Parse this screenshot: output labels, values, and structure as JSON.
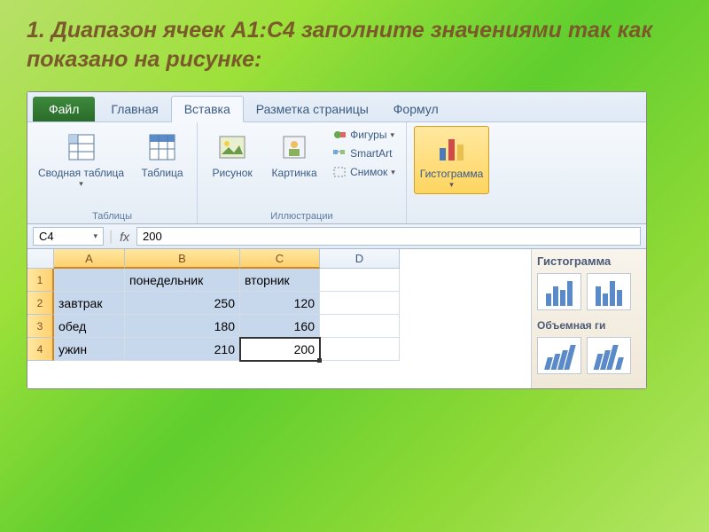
{
  "slide": {
    "title": "1. Диапазон ячеек А1:С4 заполните значениями так как показано на рисунке:"
  },
  "ribbon": {
    "file": "Файл",
    "tabs": [
      "Главная",
      "Вставка",
      "Разметка страницы",
      "Формул"
    ],
    "active_tab": "Вставка",
    "groups": {
      "tables": {
        "label": "Таблицы",
        "pivot": "Сводная таблица",
        "table": "Таблица"
      },
      "illustrations": {
        "label": "Иллюстрации",
        "picture": "Рисунок",
        "clipart": "Картинка",
        "shapes": "Фигуры",
        "smartart": "SmartArt",
        "screenshot": "Снимок"
      },
      "charts": {
        "histogram": "Гистограмма",
        "panel_title": "Гистограмма",
        "panel_3d": "Объемная ги"
      }
    }
  },
  "formula_bar": {
    "name_box": "C4",
    "fx": "fx",
    "value": "200"
  },
  "columns": [
    "A",
    "B",
    "C",
    "D"
  ],
  "selected_cols": [
    "A",
    "B",
    "C"
  ],
  "rows": [
    1,
    2,
    3,
    4
  ],
  "active_cell": "C4",
  "chart_data": {
    "type": "table",
    "title": "",
    "categories": [
      "понедельник",
      "вторник"
    ],
    "series": [
      {
        "name": "завтрак",
        "values": [
          250,
          120
        ]
      },
      {
        "name": "обед",
        "values": [
          180,
          160
        ]
      },
      {
        "name": "ужин",
        "values": [
          210,
          200
        ]
      }
    ]
  },
  "cells": {
    "A1": "",
    "B1": "понедельник",
    "C1": "вторник",
    "A2": "завтрак",
    "B2": "250",
    "C2": "120",
    "A3": "обед",
    "B3": "180",
    "C3": "160",
    "A4": "ужин",
    "B4": "210",
    "C4": "200"
  }
}
